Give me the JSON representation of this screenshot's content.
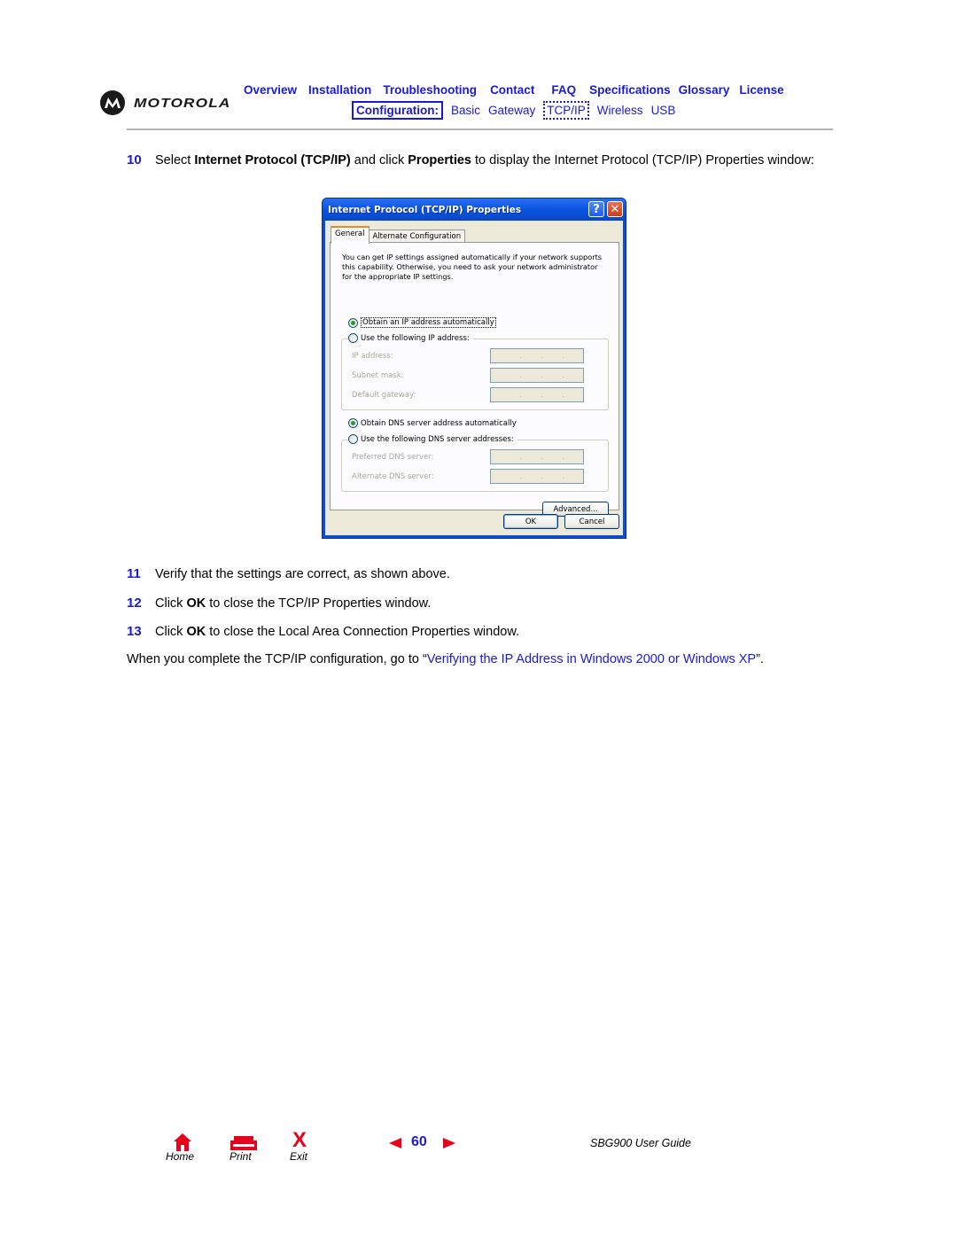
{
  "header": {
    "brand": "MOTOROLA",
    "nav_top": [
      "Overview",
      "Installation",
      "Troubleshooting",
      "Contact",
      "FAQ",
      "Specifications",
      "Glossary",
      "License"
    ],
    "nav_bottom_label": "Configuration:",
    "nav_bottom": [
      "Basic",
      "Gateway",
      "TCP/IP",
      "Wireless",
      "USB"
    ],
    "active_item": "TCP/IP",
    "accent_color": "#1a1ad0"
  },
  "steps": [
    {
      "num": "10",
      "parts": [
        "Select ",
        "Internet Protocol (TCP/IP)",
        " and click ",
        "Properties",
        " to display the Internet Protocol (TCP/IP) Properties window:"
      ]
    },
    {
      "num": "11",
      "text": "Verify that the settings are correct, as shown above."
    },
    {
      "num": "12",
      "parts": [
        "Click ",
        "OK",
        " to close the TCP/IP Properties window."
      ]
    },
    {
      "num": "13",
      "parts": [
        "Click ",
        "OK",
        " to close the Local Area Connection Properties window."
      ]
    }
  ],
  "closing": {
    "before": "When you complete the TCP/IP configuration, go to “",
    "link": "Verifying the IP Address in Windows 2000 or Windows XP",
    "after": "”."
  },
  "dialog": {
    "title": "Internet Protocol (TCP/IP) Properties",
    "help_glyph": "?",
    "close_glyph": "✕",
    "tabs": [
      "General",
      "Alternate Configuration"
    ],
    "active_tab": "General",
    "intro": "You can get IP settings assigned automatically if your network supports this capability. Otherwise, you need to ask your network administrator for the appropriate IP settings.",
    "ip_auto_label": "Obtain an IP address automatically",
    "ip_auto_selected": true,
    "ip_manual_label": "Use the following IP address:",
    "ip_fields": [
      {
        "label": "IP address:",
        "value": ". . ."
      },
      {
        "label": "Subnet mask:",
        "value": ". . ."
      },
      {
        "label": "Default gateway:",
        "value": ". . ."
      }
    ],
    "dns_auto_label": "Obtain DNS server address automatically",
    "dns_auto_selected": true,
    "dns_manual_label": "Use the following DNS server addresses:",
    "dns_fields": [
      {
        "label": "Preferred DNS server:",
        "value": ". . ."
      },
      {
        "label": "Alternate DNS server:",
        "value": ". . ."
      }
    ],
    "advanced_label": "Advanced...",
    "ok_label": "OK",
    "cancel_label": "Cancel"
  },
  "footer": {
    "home_label": "Home",
    "print_label": "Print",
    "exit_label": "Exit",
    "exit_glyph": "X",
    "page_number": "60",
    "guide_title": "SBG900 User Guide",
    "icon_color": "#e8001c"
  }
}
